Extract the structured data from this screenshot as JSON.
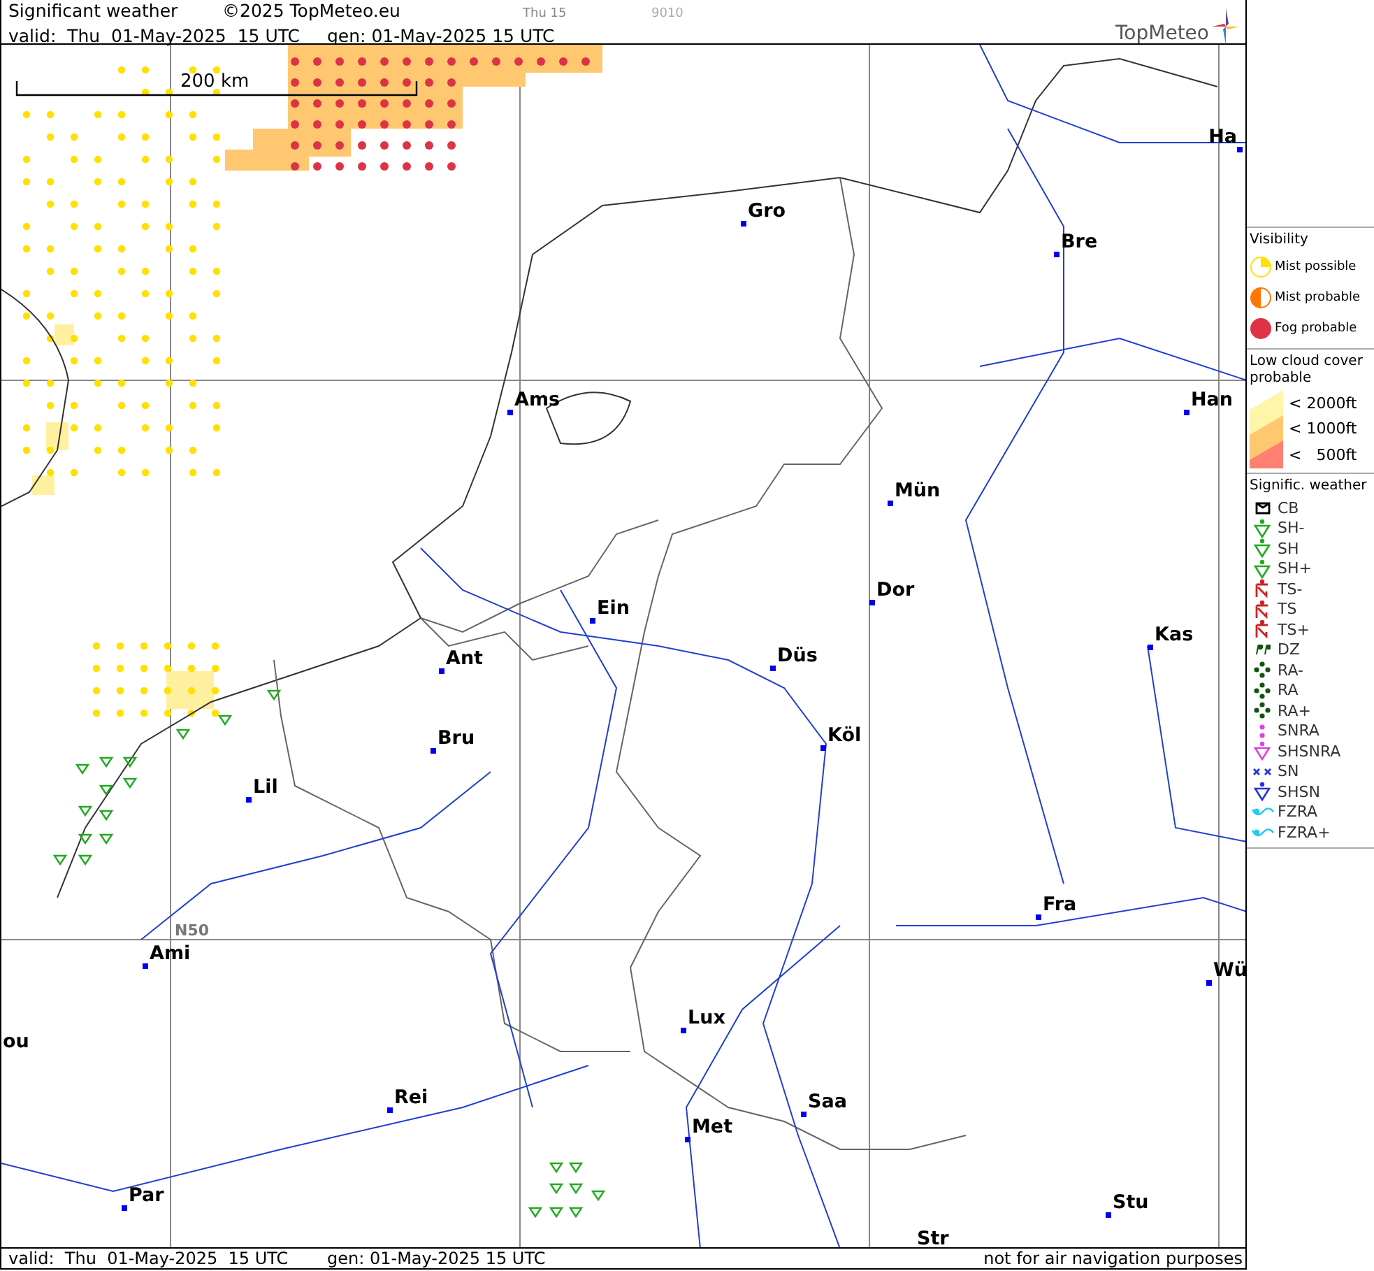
{
  "header": {
    "title": "Significant weather",
    "copyright": "©2025 TopMeteo.eu",
    "forecast_time": "Thu 15",
    "code": "9010",
    "valid": "valid:  Thu  01-May-2025  15 UTC",
    "generated": "gen: 01-May-2025 15 UTC",
    "logo": "TopMeteo"
  },
  "map": {
    "scale": "200 km",
    "grid_label": "N50",
    "cities": [
      {
        "name": "Gro"
      },
      {
        "name": "Bre"
      },
      {
        "name": "Ha"
      },
      {
        "name": "Ams"
      },
      {
        "name": "Han"
      },
      {
        "name": "Mün"
      },
      {
        "name": "Dor"
      },
      {
        "name": "Ein"
      },
      {
        "name": "Kas"
      },
      {
        "name": "Ant"
      },
      {
        "name": "Düs"
      },
      {
        "name": "Köl"
      },
      {
        "name": "Bru"
      },
      {
        "name": "Lil"
      },
      {
        "name": "Fra"
      },
      {
        "name": "Ami"
      },
      {
        "name": "Wü"
      },
      {
        "name": "Lux"
      },
      {
        "name": "ou"
      },
      {
        "name": "Rei"
      },
      {
        "name": "Saa"
      },
      {
        "name": "Met"
      },
      {
        "name": "Par"
      },
      {
        "name": "Stu"
      },
      {
        "name": "Str"
      }
    ]
  },
  "footer": {
    "valid": "valid:  Thu  01-May-2025  15 UTC",
    "generated": "gen: 01-May-2025 15 UTC",
    "note": "not for air navigation purposes"
  },
  "legend": {
    "visibility": {
      "title": "Visibility",
      "items": [
        {
          "label": "Mist possible",
          "kind": "mist"
        },
        {
          "label": "Mist probable",
          "kind": "half"
        },
        {
          "label": "Fog probable",
          "kind": "fog"
        }
      ]
    },
    "low_cloud": {
      "title": "Low cloud cover probable",
      "levels": [
        "< 2000ft",
        "< 1000ft",
        "<   500ft"
      ]
    },
    "weather": {
      "title": "Signific. weather",
      "items": [
        {
          "label": "CB",
          "kind": "cb",
          "color": "#000000"
        },
        {
          "label": "SH-",
          "kind": "shower",
          "color": "#22aa22"
        },
        {
          "label": "SH",
          "kind": "shower",
          "color": "#22aa22"
        },
        {
          "label": "SH+",
          "kind": "shower",
          "color": "#22aa22"
        },
        {
          "label": "TS-",
          "kind": "thunder",
          "color": "#cc2222"
        },
        {
          "label": "TS",
          "kind": "thunder",
          "color": "#cc2222"
        },
        {
          "label": "TS+",
          "kind": "thunder",
          "color": "#cc2222"
        },
        {
          "label": "DZ",
          "kind": "drizzle",
          "color": "#115511"
        },
        {
          "label": "RA-",
          "kind": "rain",
          "color": "#115511"
        },
        {
          "label": "RA",
          "kind": "rain",
          "color": "#115511"
        },
        {
          "label": "RA+",
          "kind": "rain",
          "color": "#115511"
        },
        {
          "label": "SNRA",
          "kind": "dots",
          "color": "#dd44dd"
        },
        {
          "label": "SHSNRA",
          "kind": "shower",
          "color": "#dd44dd"
        },
        {
          "label": "SN",
          "kind": "snow",
          "color": "#2233dd"
        },
        {
          "label": "SHSN",
          "kind": "shower",
          "color": "#2233dd"
        },
        {
          "label": "FZRA",
          "kind": "freezing",
          "color": "#22ccee"
        },
        {
          "label": "FZRA+",
          "kind": "freezing",
          "color": "#22ccee"
        }
      ]
    }
  }
}
